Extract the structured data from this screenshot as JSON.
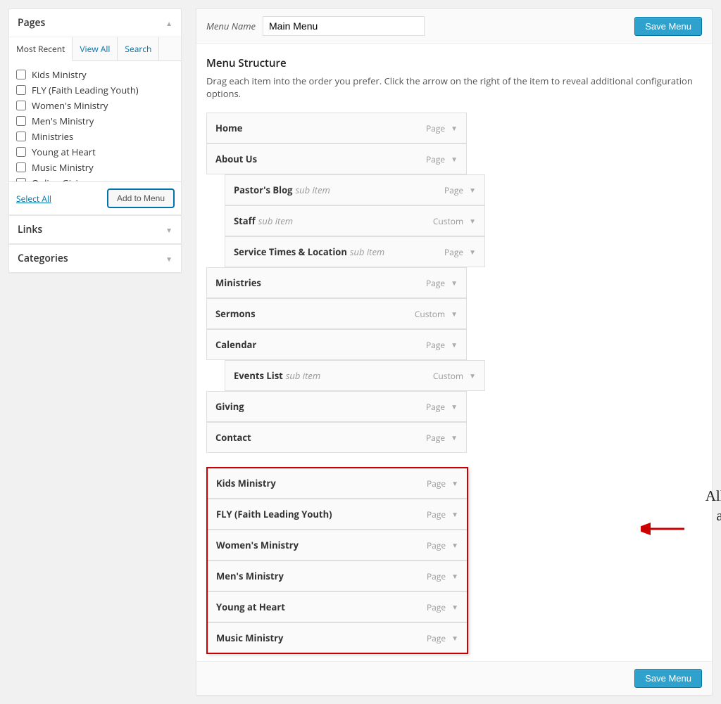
{
  "sidebar": {
    "pages_panel_title": "Pages",
    "links_panel_title": "Links",
    "categories_panel_title": "Categories",
    "tabs": [
      "Most Recent",
      "View All",
      "Search"
    ],
    "pages": [
      "Kids Ministry",
      "FLY (Faith Leading Youth)",
      "Women's Ministry",
      "Men's Ministry",
      "Ministries",
      "Young at Heart",
      "Music Ministry",
      "Online Giving"
    ],
    "select_all": "Select All",
    "add_to_menu": "Add to Menu"
  },
  "header": {
    "menu_name_label": "Menu Name",
    "menu_name_value": "Main Menu",
    "save": "Save Menu"
  },
  "structure": {
    "title": "Menu Structure",
    "desc": "Drag each item into the order you prefer. Click the arrow on the right of the item to reveal additional configuration options.",
    "sub_item_label": "sub item",
    "items": [
      {
        "label": "Home",
        "type": "Page",
        "indent": 0
      },
      {
        "label": "About Us",
        "type": "Page",
        "indent": 0
      },
      {
        "label": "Pastor's Blog",
        "type": "Page",
        "indent": 1,
        "sub": true
      },
      {
        "label": "Staff",
        "type": "Custom",
        "indent": 1,
        "sub": true
      },
      {
        "label": "Service Times & Location",
        "type": "Page",
        "indent": 1,
        "sub": true
      },
      {
        "label": "Ministries",
        "type": "Page",
        "indent": 0
      },
      {
        "label": "Sermons",
        "type": "Custom",
        "indent": 0
      },
      {
        "label": "Calendar",
        "type": "Page",
        "indent": 0
      },
      {
        "label": "Events List",
        "type": "Custom",
        "indent": 1,
        "sub": true
      },
      {
        "label": "Giving",
        "type": "Page",
        "indent": 0
      },
      {
        "label": "Contact",
        "type": "Page",
        "indent": 0
      }
    ],
    "highlighted_items": [
      {
        "label": "Kids Ministry",
        "type": "Page"
      },
      {
        "label": "FLY (Faith Leading Youth)",
        "type": "Page"
      },
      {
        "label": "Women's Ministry",
        "type": "Page"
      },
      {
        "label": "Men's Ministry",
        "type": "Page"
      },
      {
        "label": "Young at Heart",
        "type": "Page"
      },
      {
        "label": "Music Ministry",
        "type": "Page"
      }
    ]
  },
  "annotation": {
    "text": "All of the selected pages were added to the bottom of the menu."
  },
  "footer": {
    "save": "Save Menu"
  }
}
